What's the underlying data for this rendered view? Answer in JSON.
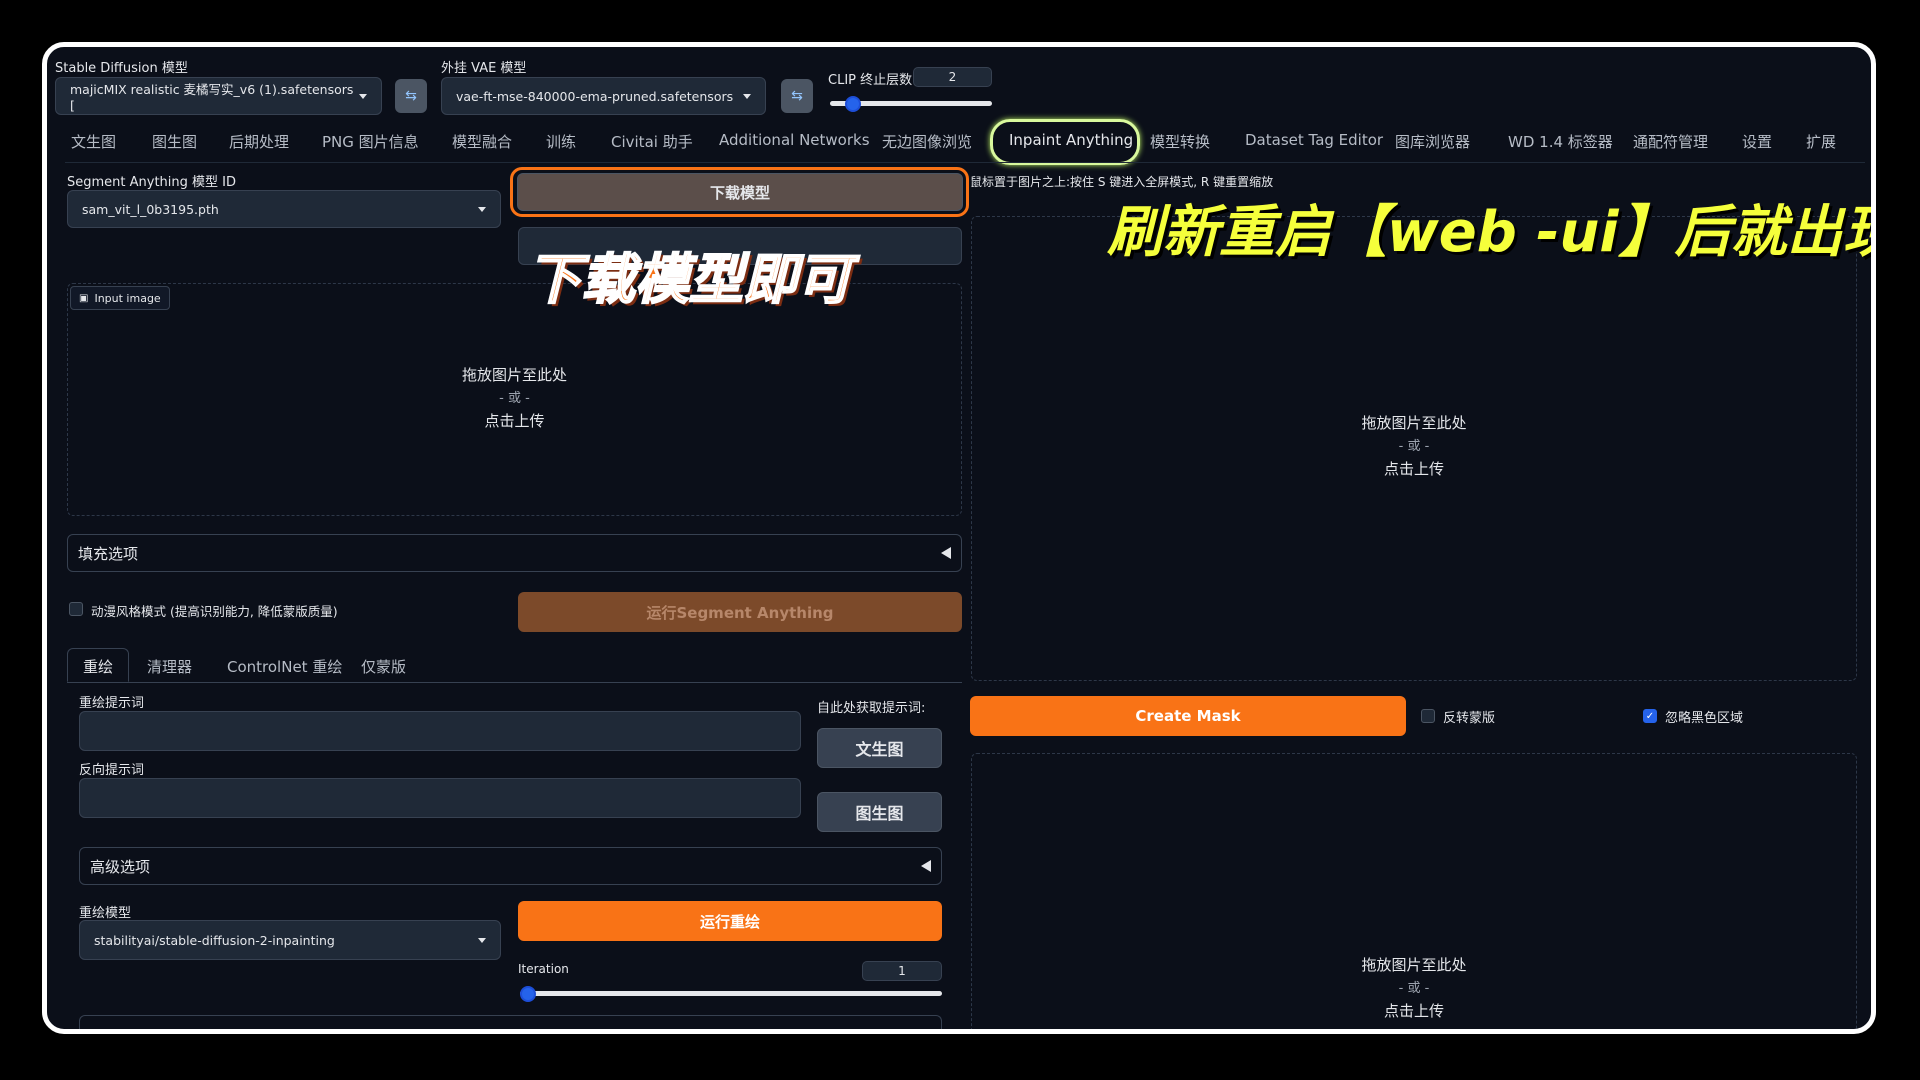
{
  "top": {
    "sd_model_label": "Stable Diffusion 模型",
    "sd_model_value": "majicMIX realistic 麦橘写实_v6 (1).safetensors [",
    "vae_label": "外挂 VAE 模型",
    "vae_value": "vae-ft-mse-840000-ema-pruned.safetensors",
    "clip_label": "CLIP 终止层数",
    "clip_value": "2",
    "clip_fraction": 0.1
  },
  "tabs": [
    "文生图",
    "图生图",
    "后期处理",
    "PNG 图片信息",
    "模型融合",
    "训练",
    "Civitai 助手",
    "Additional Networks",
    "无边图像浏览",
    "Inpaint Anything",
    "模型转换",
    "Dataset Tag Editor",
    "图库浏览器",
    "WD 1.4 标签器",
    "通配符管理",
    "设置",
    "扩展"
  ],
  "active_tab": "Inpaint Anything",
  "left": {
    "sam_label": "Segment Anything 模型 ID",
    "sam_value": "sam_vit_l_0b3195.pth",
    "download_button": "下载模型",
    "input_image_label": "Input image",
    "drop_main": "拖放图片至此处",
    "drop_or": "- 或 -",
    "drop_click": "点击上传",
    "fill_options": "填充选项",
    "anime_mode": "动漫风格模式 (提高识别能力, 降低蒙版质量)",
    "run_sam": "运行Segment Anything",
    "subtabs": [
      "重绘",
      "清理器",
      "ControlNet 重绘",
      "仅蒙版"
    ],
    "prompt_label": "重绘提示词",
    "neg_prompt_label": "反向提示词",
    "get_prompt_label": "自此处获取提示词:",
    "txt2img_btn": "文生图",
    "img2img_btn": "图生图",
    "advanced": "高级选项",
    "inpaint_model_label": "重绘模型",
    "inpaint_model_value": "stabilityai/stable-diffusion-2-inpainting",
    "run_inpaint": "运行重绘",
    "iteration_label": "Iteration",
    "iteration_value": "1",
    "iteration_fraction": 0.0
  },
  "right": {
    "hint": "鼠标置于图片之上:按住 S 键进入全屏模式, R 键重置缩放",
    "drop_main": "拖放图片至此处",
    "drop_or": "- 或 -",
    "drop_click": "点击上传",
    "create_mask": "Create Mask",
    "invert_mask": "反转蒙版",
    "invert_checked": false,
    "ignore_black": "忽略黑色区域",
    "ignore_checked": true
  },
  "annotations": {
    "download_hint": "下载模型即可",
    "refresh_hint": "刷新重启【web -ui】后就出现了",
    "download_color": "#f97316",
    "refresh_color": "#f5ff3b"
  }
}
